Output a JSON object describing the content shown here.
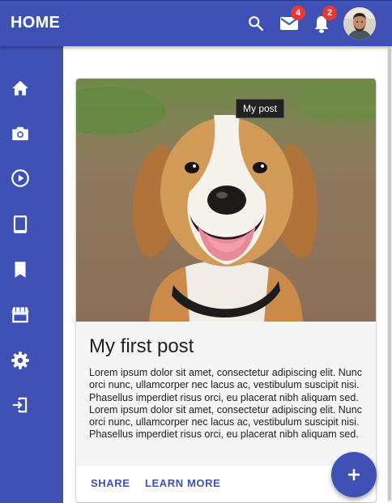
{
  "appbar": {
    "title": "HOME",
    "mail_badge": "4",
    "notifications_badge": "2"
  },
  "sidebar": {
    "items": [
      {
        "icon": "home-icon"
      },
      {
        "icon": "camera-icon"
      },
      {
        "icon": "play-circle-icon"
      },
      {
        "icon": "tablet-icon"
      },
      {
        "icon": "bookmark-icon"
      },
      {
        "icon": "store-icon"
      },
      {
        "icon": "gear-icon"
      },
      {
        "icon": "login-icon"
      }
    ]
  },
  "card": {
    "tooltip": "My post",
    "title": "My first post",
    "body": "Lorem ipsum dolor sit amet, consectetur adipiscing elit. Nunc orci nunc, ullamcorper nec lacus ac, vestibulum suscipit nisi. Phasellus imperdiet risus orci, eu placerat nibh aliquam sed. Lorem ipsum dolor sit amet, consectetur adipiscing elit. Nunc orci nunc, ullamcorper nec lacus ac, vestibulum suscipit nisi. Phasellus imperdiet risus orci, eu placerat nibh aliquam sed.",
    "share_label": "SHARE",
    "learn_more_label": "LEARN MORE"
  },
  "colors": {
    "primary": "#3f51b5",
    "badge": "#e53935"
  }
}
